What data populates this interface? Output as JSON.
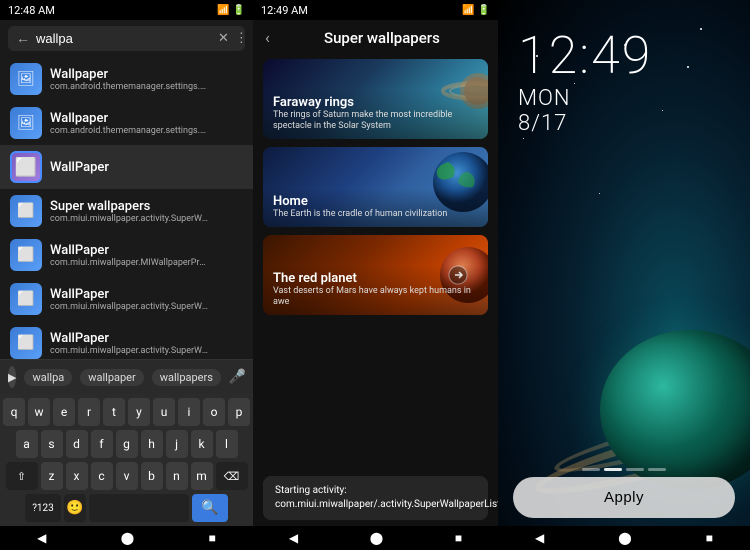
{
  "panel1": {
    "status_time": "12:48 AM",
    "search_placeholder": "wallpa",
    "results": [
      {
        "title": "Wallpaper",
        "subtitle": "com.android.thememanager.settings.FontSettingsActivity",
        "icon_type": "blue"
      },
      {
        "title": "Wallpaper",
        "subtitle": "com.android.thememanager.settings.WallpaperSettingsActivity",
        "icon_type": "blue"
      },
      {
        "title": "WallPaper",
        "subtitle": "",
        "icon_type": "purple",
        "active": true
      },
      {
        "title": "Super wallpapers",
        "subtitle": "com.miui.miwallpaper.activity.SuperWallpaperListActivity",
        "icon_type": "blue"
      },
      {
        "title": "WallPaper",
        "subtitle": "com.miui.miwallpaper.MIWallpaperPreview",
        "icon_type": "blue"
      },
      {
        "title": "WallPaper",
        "subtitle": "com.miui.miwallpaper.activity.SuperWallpaperScaleTestActivity",
        "icon_type": "blue"
      },
      {
        "title": "WallPaper",
        "subtitle": "com.miui.miwallpaper.activity.SuperWallpaperSettingActivity",
        "icon_type": "blue"
      }
    ],
    "suggestions": [
      "wallpa",
      "wallpaper",
      "wallpapers"
    ],
    "keyboard_rows": [
      [
        "q",
        "w",
        "e",
        "r",
        "t",
        "y",
        "u",
        "i",
        "o",
        "p"
      ],
      [
        "a",
        "s",
        "d",
        "f",
        "g",
        "h",
        "j",
        "k",
        "l"
      ],
      [
        "z",
        "x",
        "c",
        "v",
        "b",
        "n",
        "m"
      ]
    ]
  },
  "panel2": {
    "status_time": "12:49 AM",
    "title": "Super wallpapers",
    "wallpapers": [
      {
        "title": "Faraway rings",
        "desc": "The rings of Saturn make the most incredible spectacle in the Solar System",
        "type": "faraway"
      },
      {
        "title": "Home",
        "desc": "The Earth is the cradle of human civilization",
        "type": "home"
      },
      {
        "title": "The red planet",
        "desc": "Vast deserts of Mars have always kept humans in awe",
        "type": "red-planet"
      }
    ],
    "toast": "Starting activity:\ncom.miui.miwallpaper/.activity.SuperWallpaperListActivity"
  },
  "panel3": {
    "time": "12:49",
    "day": "MON",
    "date": "8/17",
    "apply_label": "Apply"
  }
}
